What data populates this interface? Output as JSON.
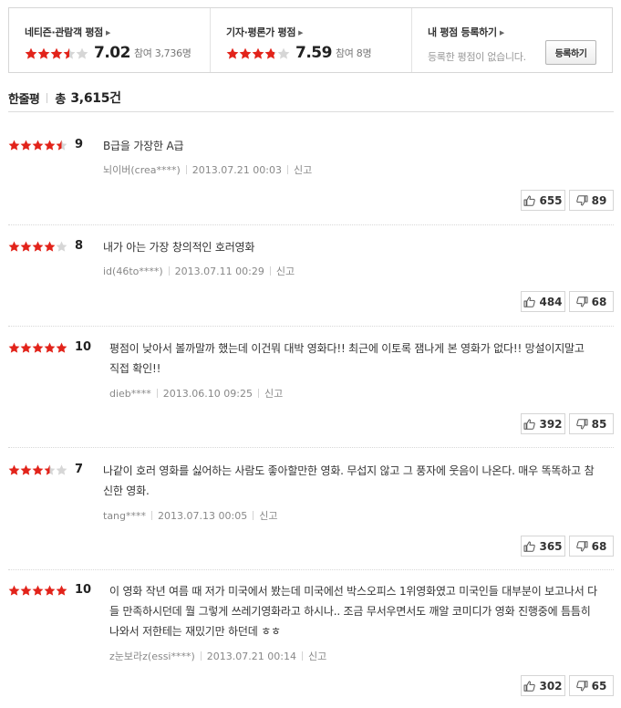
{
  "ratings": {
    "audience": {
      "title": "네티즌·관람객 평점",
      "score": "7.02",
      "stars_fraction": 0.702,
      "participants": "참여 3,736명"
    },
    "critics": {
      "title": "기자·평론가 평점",
      "score": "7.59",
      "stars_fraction": 0.759,
      "participants": "참여 8명"
    },
    "my": {
      "title": "내 평점 등록하기",
      "description": "등록한 평점이 없습니다.",
      "button_label": "등록하기"
    }
  },
  "list_header": {
    "title": "한줄평",
    "total_label": "총",
    "total_value": "3,615건"
  },
  "colors": {
    "star_filled": "#e2231a",
    "star_empty": "#d6d6d6"
  },
  "reviews": [
    {
      "score": "9",
      "stars_fraction": 0.9,
      "text": "B급을 가장한 A급",
      "author": "뇌이버(crea****)",
      "date": "2013.07.21 00:03",
      "report_label": "신고",
      "likes": "655",
      "dislikes": "89"
    },
    {
      "score": "8",
      "stars_fraction": 0.8,
      "text": "내가 아는 가장 창의적인 호러영화",
      "author": "id(46to****)",
      "date": "2013.07.11 00:29",
      "report_label": "신고",
      "likes": "484",
      "dislikes": "68"
    },
    {
      "score": "10",
      "stars_fraction": 1.0,
      "text": "평점이 낮아서 볼까말까 했는데 이건뭐 대박 영화다!! 최근에 이토록 잼나게 본 영화가 없다!! 망설이지말고 직접 확인!!",
      "author": "dieb****",
      "date": "2013.06.10 09:25",
      "report_label": "신고",
      "likes": "392",
      "dislikes": "85"
    },
    {
      "score": "7",
      "stars_fraction": 0.7,
      "text": "나같이 호러 영화를 싫어하는 사람도 좋아할만한 영화. 무섭지 않고 그 풍자에 웃음이 나온다. 매우 똑똑하고 참신한 영화.",
      "author": "tang****",
      "date": "2013.07.13 00:05",
      "report_label": "신고",
      "likes": "365",
      "dislikes": "68"
    },
    {
      "score": "10",
      "stars_fraction": 1.0,
      "text": "이 영화 작년 여름 때 저가 미국에서 봤는데 미국에선 박스오피스 1위영화였고 미국인들 대부분이 보고나서 다들 만족하시던데 뭘 그렇게 쓰레기영화라고 하시나.. 조금 무서우면서도 깨알 코미디가 영화 진행중에 틈틈히 나와서 저한테는 재밌기만 하던데 ㅎㅎ",
      "author": "z눈보라z(essi****)",
      "date": "2013.07.21 00:14",
      "report_label": "신고",
      "likes": "302",
      "dislikes": "65"
    }
  ]
}
